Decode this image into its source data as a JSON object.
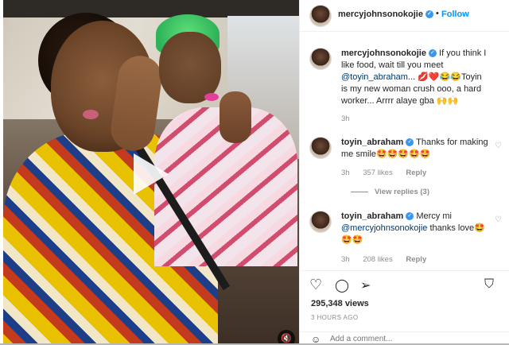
{
  "post": {
    "username": "mercyjohnsonokojie",
    "follow_label": "Follow",
    "separator": "•"
  },
  "comments": [
    {
      "username": "mercyjohnsonokojie",
      "text_before": "If you think I like food, wait till you meet ",
      "mention": "@toyin_abraham...",
      "text_after": " 💋❤️😂😂Toyin is my new woman crush ooo, a hard worker... Arrrr alaye gba 🙌🙌",
      "time": "3h"
    },
    {
      "username": "toyin_abraham",
      "text": "Thanks for making me smile🤩🤩🤩🤩🤩",
      "time": "3h",
      "likes": "357 likes",
      "reply": "Reply",
      "view_replies": "View replies (3)"
    },
    {
      "username": "toyin_abraham",
      "text_before": "Mercy mi ",
      "mention": "@mercyjohnsonokojie",
      "text_after": " thanks love🤩🤩🤩",
      "time": "3h",
      "likes": "208 likes",
      "reply": "Reply"
    }
  ],
  "stats": {
    "views": "295,348 views",
    "posted": "3 HOURS AGO"
  },
  "add_comment": {
    "placeholder": "Add a comment..."
  },
  "icons": [
    "heart-icon",
    "comment-icon",
    "share-icon",
    "bookmark-icon",
    "verified-icon",
    "play-icon",
    "mute-icon",
    "emoji-icon"
  ],
  "colors": {
    "accent": "#0095f6",
    "verified": "#3897f0",
    "text": "#262626",
    "muted": "#8e8e8e"
  }
}
